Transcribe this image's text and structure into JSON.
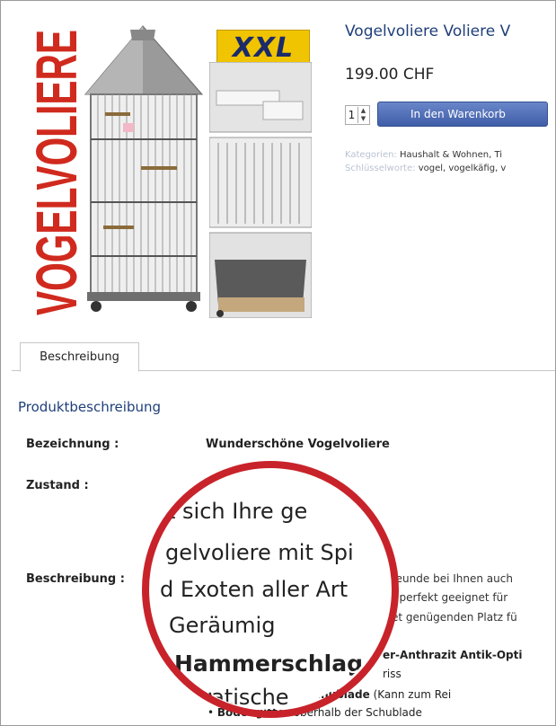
{
  "product": {
    "image_side_text": "VOGELVOLIERE",
    "badge": "XXL",
    "title": "Vogelvoliere Voliere V",
    "price": "199.00 CHF",
    "quantity": "1",
    "cart_button": "In den Warenkorb",
    "categories_label": "Kategorien:",
    "categories_value": "Haushalt & Wohnen, Ti",
    "keywords_label": "Schlüsselworte:",
    "keywords_value": "vogel, vogelkäfig, v"
  },
  "tabs": [
    {
      "label": "Beschreibung"
    }
  ],
  "description": {
    "section_title": "Produktbeschreibung",
    "rows": [
      {
        "label": "Bezeichnung :",
        "value": "Wunderschöne Vogelvoliere"
      },
      {
        "label": "Zustand :",
        "value": "N"
      },
      {
        "label": "Beschreibung :",
        "value": ""
      }
    ],
    "text_lines": [
      "reunde bei Ihnen auch",
      "t perfekt geeignet für",
      "et genügenden Platz fü"
    ],
    "bullets": [
      {
        "prefix": "",
        "bold": "",
        "suffix": "er-Anthrazit Antik-Opti"
      },
      {
        "prefix": "",
        "bold": "",
        "suffix": "riss"
      },
      {
        "prefix": "• Mi",
        "bold": "Sandschublade",
        "suffix": " (Kann zum Rei"
      },
      {
        "prefix": "• ",
        "bold": "Bodengitter",
        "suffix": " oberhalb der Schublade"
      }
    ]
  },
  "magnifier": {
    "lines": [
      "t sich Ihre ge",
      "gelvoliere mit Spi",
      "d Exoten aller Art",
      "Geräumig",
      "Hammerschlag",
      "dratische"
    ],
    "ring_color": "#c8232a"
  },
  "colors": {
    "link_blue": "#1f3f7a",
    "button_blue": "#3f5ea8",
    "badge_yellow": "#f0c400",
    "side_text_red": "#d02a1e"
  }
}
